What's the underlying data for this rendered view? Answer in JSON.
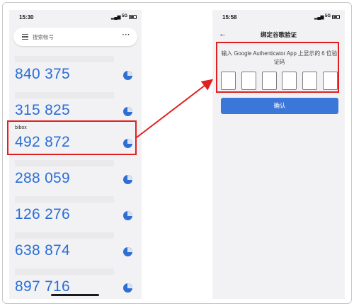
{
  "left_phone": {
    "status": {
      "time": "15:30",
      "network": "5G"
    },
    "search": {
      "placeholder": "搜索帐号"
    },
    "accounts": [
      {
        "label": "",
        "code": "840 375"
      },
      {
        "label": "",
        "code": "315 825"
      },
      {
        "label": "bibox",
        "code": "492 872"
      },
      {
        "label": "",
        "code": "288 059"
      },
      {
        "label": "",
        "code": "126 276"
      },
      {
        "label": "",
        "code": "638 874"
      },
      {
        "label": "",
        "code": "897 716"
      }
    ]
  },
  "right_phone": {
    "status": {
      "time": "15:58",
      "network": "5G"
    },
    "title": "绑定谷歌验证",
    "prompt": "输入 Google Authenticator App 上显示的 6 位验证码",
    "confirm_label": "确认"
  },
  "colors": {
    "accent": "#3b76d9",
    "code_text": "#2b6ed6",
    "highlight": "#e02020"
  }
}
